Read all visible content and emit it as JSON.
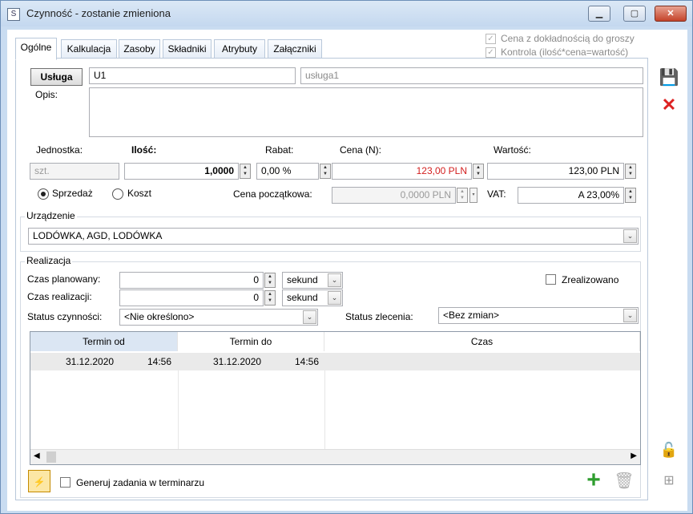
{
  "window": {
    "title": "Czynność - zostanie zmieniona"
  },
  "tabs": [
    "Ogólne",
    "Kalkulacja",
    "Zasoby",
    "Składniki",
    "Atrybuty",
    "Załączniki"
  ],
  "options": {
    "price_to_grosz": "Cena z dokładnością do groszy",
    "control": "Kontrola (ilość*cena=wartość)"
  },
  "service": {
    "button": "Usługa",
    "code": "U1",
    "name": "usługa1",
    "desc_label": "Opis:"
  },
  "pricing": {
    "unit_label": "Jednostka:",
    "qty_label": "Ilość:",
    "discount_label": "Rabat:",
    "price_label": "Cena (N):",
    "value_label": "Wartość:",
    "unit": "szt.",
    "qty": "1,0000",
    "discount": "0,00 %",
    "price": "123,00 PLN",
    "value": "123,00 PLN",
    "sale_label": "Sprzedaż",
    "cost_label": "Koszt",
    "initial_price_label": "Cena początkowa:",
    "initial_price": "0,0000 PLN",
    "vat_label": "VAT:",
    "vat": "A 23,00%"
  },
  "device": {
    "label": "Urządzenie",
    "value": "LODÓWKA, AGD, LODÓWKA"
  },
  "realization": {
    "label": "Realizacja",
    "planned_label": "Czas planowany:",
    "planned_value": "0",
    "planned_unit": "sekund",
    "actual_label": "Czas realizacji:",
    "actual_value": "0",
    "actual_unit": "sekund",
    "realized_label": "Zrealizowano",
    "status_label": "Status czynności:",
    "status_value": "<Nie określono>",
    "order_status_label": "Status zlecenia:",
    "order_status_value": "<Bez zmian>"
  },
  "table": {
    "columns": [
      "Termin od",
      "Termin do",
      "Czas"
    ],
    "rows": [
      {
        "from_date": "31.12.2020",
        "from_time": "14:56",
        "to_date": "31.12.2020",
        "to_time": "14:56",
        "duration": ""
      }
    ]
  },
  "footer": {
    "generate_tasks": "Generuj zadania w terminarzu"
  }
}
